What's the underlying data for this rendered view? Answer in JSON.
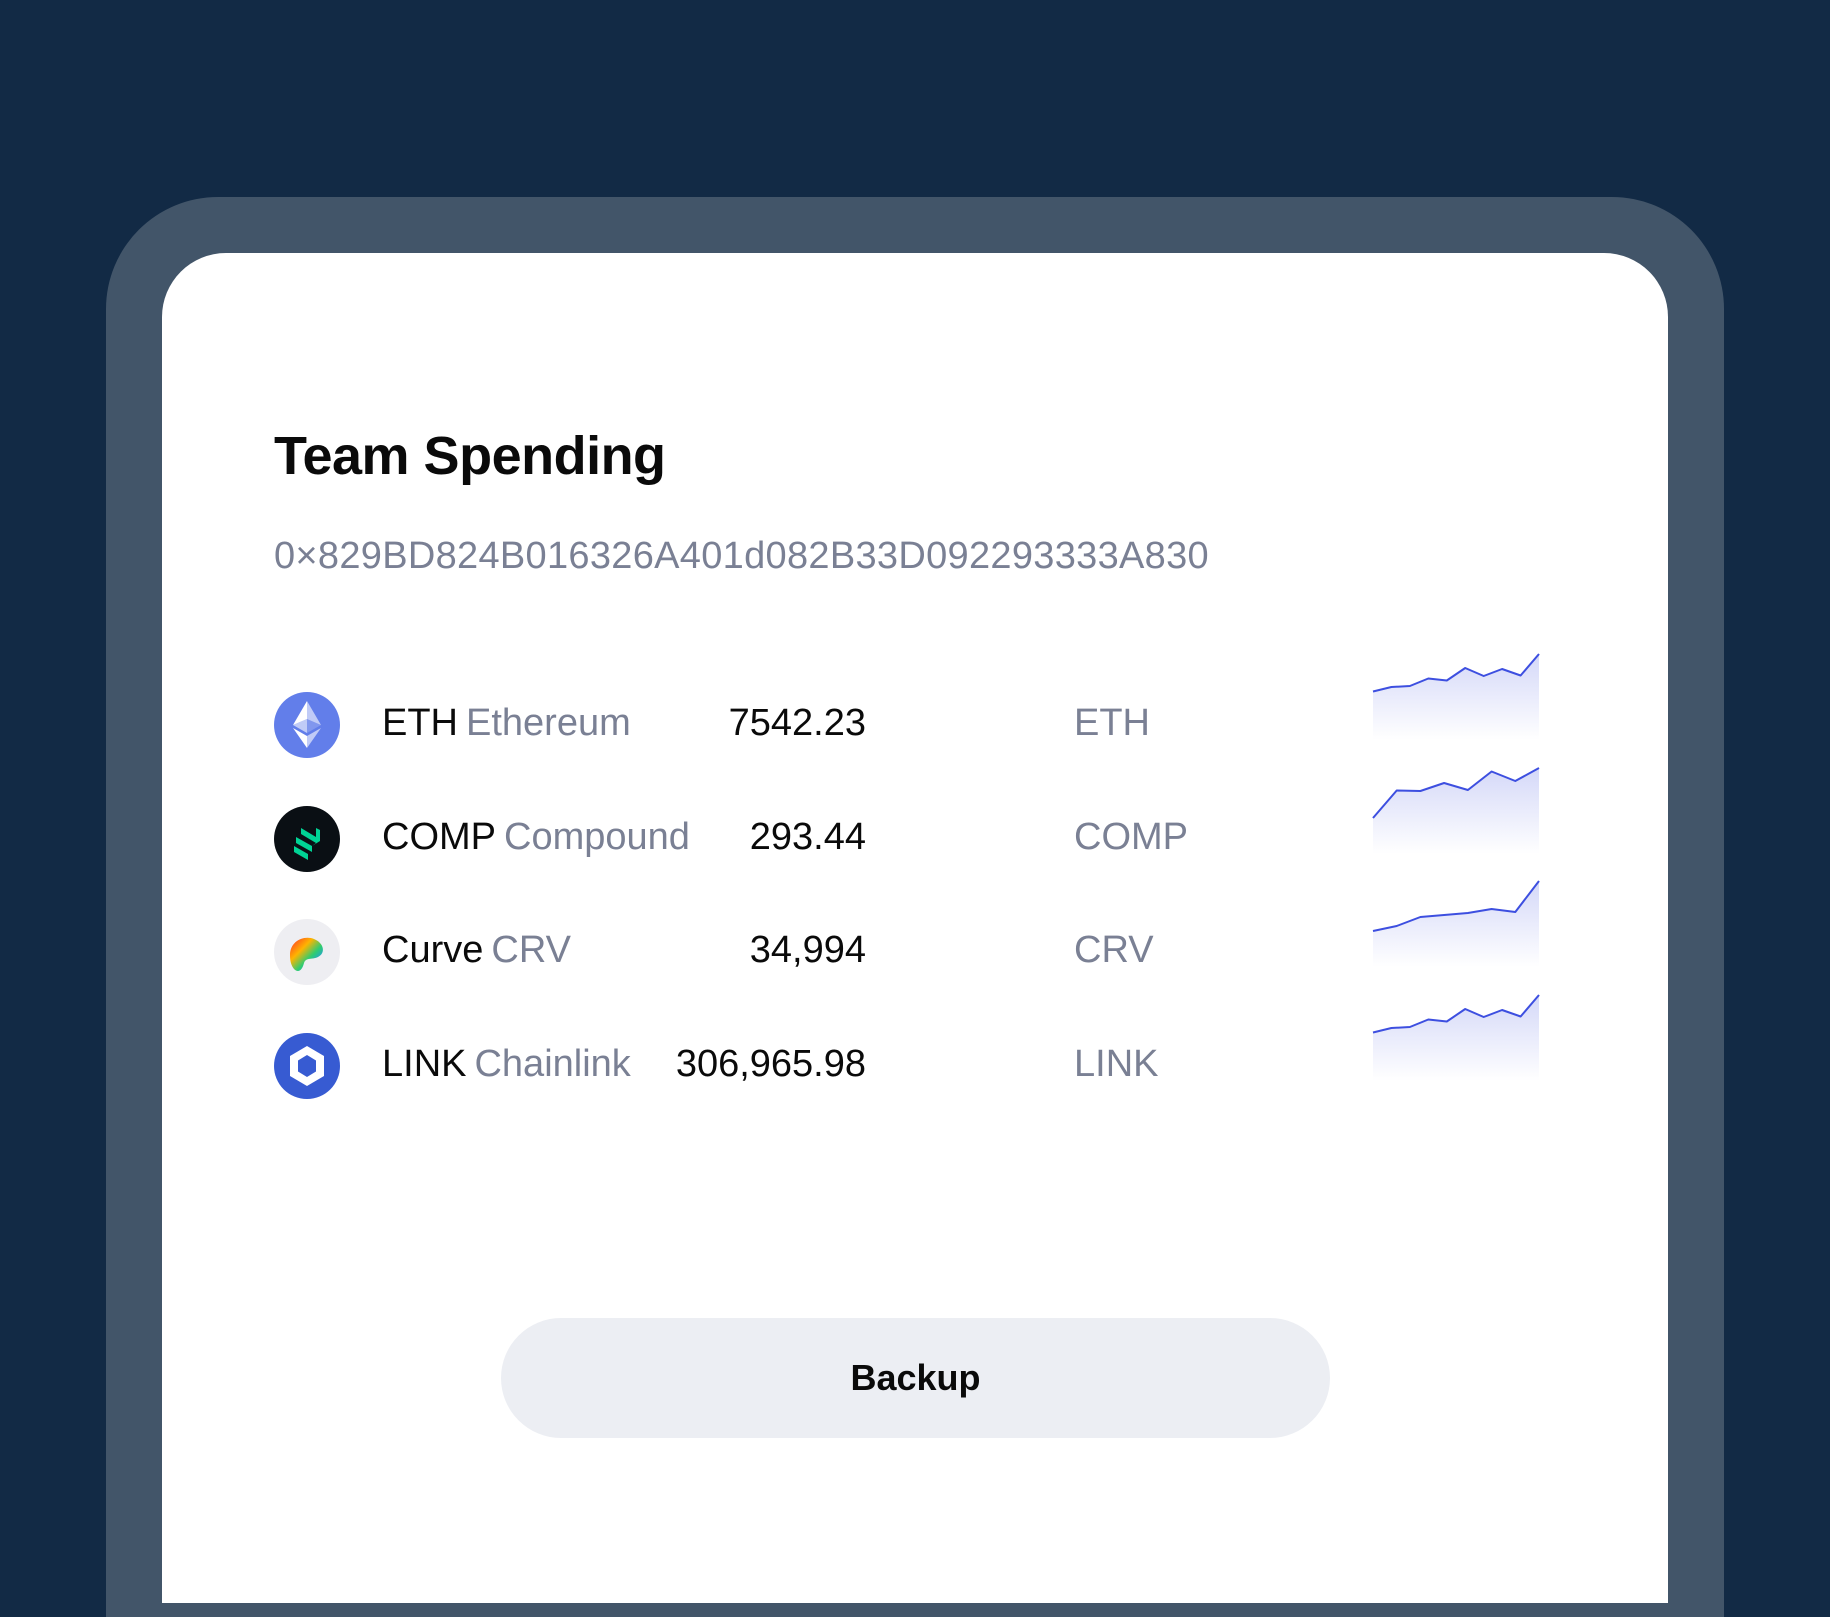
{
  "wallet": {
    "title": "Team Spending",
    "address": "0×829BD824B016326A401d082B33D092293333A830"
  },
  "assets": [
    {
      "symbol": "ETH",
      "name": "Ethereum",
      "amount": "7542.23",
      "unit": "ETH",
      "icon": "ethereum-icon",
      "trend": [
        0.25,
        0.34,
        0.36,
        0.51,
        0.47,
        0.72,
        0.56,
        0.7,
        0.57,
        1.0
      ]
    },
    {
      "symbol": "COMP",
      "name": "Compound",
      "amount": "293.44",
      "unit": "COMP",
      "icon": "compound-icon",
      "trend": [
        0.0,
        0.55,
        0.54,
        0.7,
        0.56,
        0.93,
        0.74,
        1.0
      ]
    },
    {
      "symbol": "Curve",
      "name": "CRV",
      "amount": "34,994",
      "unit": "CRV",
      "icon": "curve-icon",
      "trend": [
        0.0,
        0.1,
        0.28,
        0.32,
        0.36,
        0.44,
        0.38,
        1.0
      ]
    },
    {
      "symbol": "LINK",
      "name": "Chainlink",
      "amount": "306,965.98",
      "unit": "LINK",
      "icon": "chainlink-icon",
      "trend": [
        0.25,
        0.34,
        0.36,
        0.51,
        0.47,
        0.72,
        0.56,
        0.7,
        0.57,
        1.0
      ]
    }
  ],
  "colors": {
    "background": "#122a45",
    "device_frame": "#425569",
    "screen": "#ffffff",
    "muted_text": "#7a8094",
    "sparkline": "#3d4fe0",
    "button_bg": "#eceef3",
    "eth_brand": "#627eea",
    "comp_brand": "#00d395",
    "link_brand": "#375bd2"
  },
  "actions": {
    "backup_label": "Backup"
  }
}
